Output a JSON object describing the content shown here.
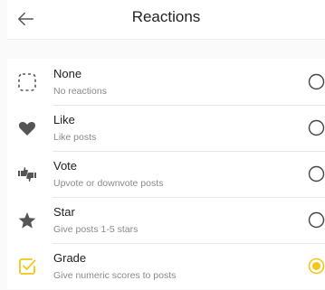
{
  "header": {
    "title": "Reactions"
  },
  "colors": {
    "accent": "#f5c518",
    "icon": "#555555"
  },
  "options": [
    {
      "label": "None",
      "description": "No reactions",
      "icon": "dashed-square-icon",
      "selected": false
    },
    {
      "label": "Like",
      "description": "Like posts",
      "icon": "heart-icon",
      "selected": false
    },
    {
      "label": "Vote",
      "description": "Upvote or downvote posts",
      "icon": "thumbs-up-down-icon",
      "selected": false
    },
    {
      "label": "Star",
      "description": "Give posts 1-5 stars",
      "icon": "star-icon",
      "selected": false
    },
    {
      "label": "Grade",
      "description": "Give numeric scores to posts",
      "icon": "grade-checkbox-icon",
      "selected": true
    }
  ]
}
